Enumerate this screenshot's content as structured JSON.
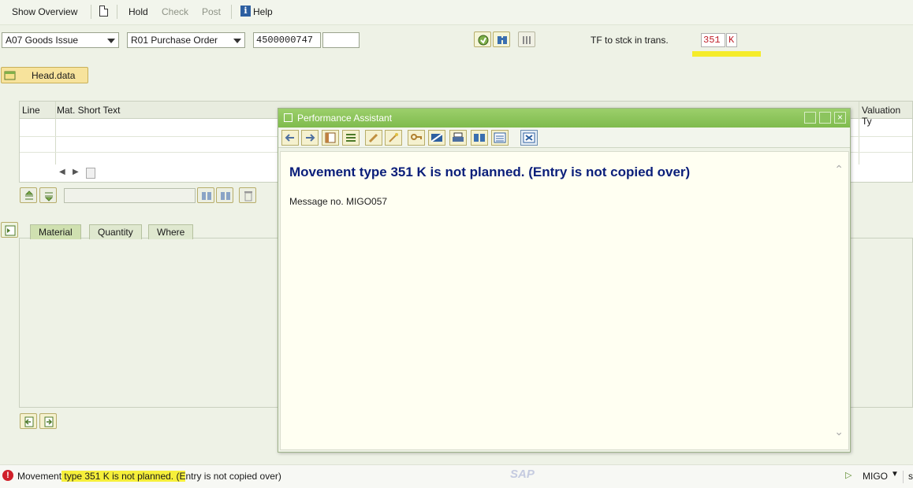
{
  "toolbar": {
    "show_overview": "Show Overview",
    "hold": "Hold",
    "check": "Check",
    "post": "Post",
    "help": "Help"
  },
  "selection": {
    "transaction": "A07 Goods Issue",
    "reference": "R01 Purchase Order",
    "doc_number": "4500000747",
    "doc_extra": "",
    "movement_label": "TF to stck in trans.",
    "movement_type": "351",
    "special_stock": "K"
  },
  "head_button": "Head.data",
  "grid": {
    "columns": [
      "Line",
      "Mat. Short Text",
      "Valuation Ty"
    ]
  },
  "tabs": [
    "Material",
    "Quantity",
    "Where"
  ],
  "dialog": {
    "title": "Performance Assistant",
    "heading": "Movement type 351 K is not planned. (Entry is not copied over)",
    "message": "Message no. MIGO057"
  },
  "status": {
    "message_pre": "Movement type 351 K is not planned. (Entry is not copied over)",
    "transaction": "MIGO",
    "extra": "s"
  },
  "brand": "SAP"
}
